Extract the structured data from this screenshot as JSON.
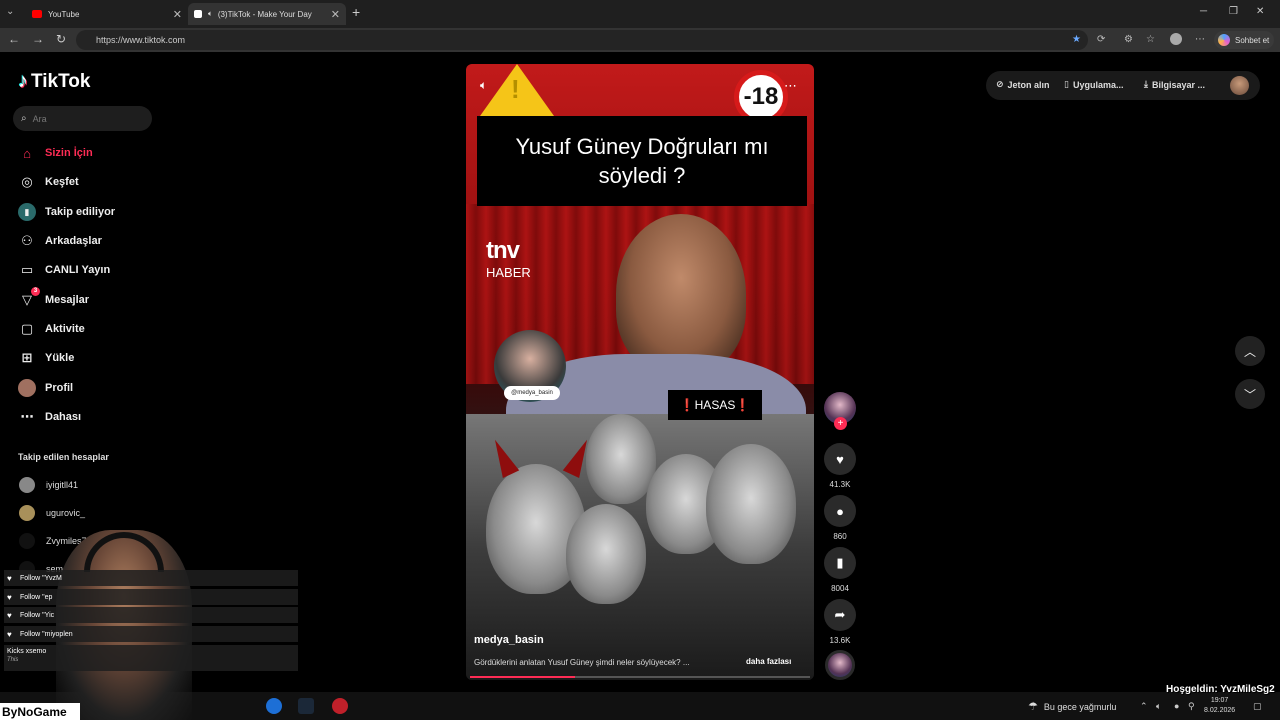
{
  "browser": {
    "tabs": [
      {
        "title": "YouTube",
        "color": "#ff0000"
      },
      {
        "title": "(3)TikTok - Make Your Day",
        "color": "#ffffff"
      }
    ],
    "url": "https://www.tiktok.com",
    "chat_label": "Sohbet et",
    "icons": [
      "back-icon",
      "forward-icon",
      "reload-icon",
      "star-icon",
      "extensions-icon",
      "profile-icon",
      "menu-icon"
    ]
  },
  "sidebar": {
    "logo": "TikTok",
    "search_placeholder": "Ara",
    "nav": [
      {
        "label": "Sizin İçin",
        "icon": "home-icon",
        "active": true
      },
      {
        "label": "Keşfet",
        "icon": "compass-icon"
      },
      {
        "label": "Takip ediliyor",
        "icon": "following-icon"
      },
      {
        "label": "Arkadaşlar",
        "icon": "friends-icon"
      },
      {
        "label": "CANLI Yayın",
        "icon": "live-icon"
      },
      {
        "label": "Mesajlar",
        "icon": "message-icon",
        "badge": "3"
      },
      {
        "label": "Aktivite",
        "icon": "activity-icon"
      },
      {
        "label": "Yükle",
        "icon": "upload-icon"
      },
      {
        "label": "Profil",
        "icon": "profile-icon"
      },
      {
        "label": "Dahası",
        "icon": "more-icon"
      }
    ],
    "following_title": "Takip edilen hesaplar",
    "following": [
      "iyigitll41",
      "ugurovic_",
      "Zvymiles7",
      "semo"
    ]
  },
  "video": {
    "title": "Yusuf Güney Doğruları mı söyledi ?",
    "channel_logo": "tnv",
    "channel_sub": "HABER",
    "age_label": "-18",
    "overlay_handle": "@medya_basin",
    "hasas": "❗HASAS❗",
    "username": "medya_basin",
    "description": "Gördüklerini anlatan Yusuf Güney şimdi neler söylüyecek? ...",
    "more": "daha fazlası",
    "progress": 0.31
  },
  "actions": {
    "likes": "41.3K",
    "comments": "860",
    "saves": "8004",
    "shares": "13.6K"
  },
  "topbar": {
    "coins": "Jeton alın",
    "app": "Uygulama...",
    "desktop": "Bilgisayar ..."
  },
  "stream": {
    "chat": [
      "Follow \"YvzM",
      "Follow \"ep",
      "Follow \"Yic",
      "Follow \"miyoplen"
    ],
    "kicks_label": "Kicks xsemo",
    "kicks_sub": "This",
    "brand": "ByNoGame",
    "welcome": "Hoşgeldin: YvzMileSg2"
  },
  "taskbar": {
    "weather": "Bu gece yağmurlu",
    "time": "19:07",
    "date": "8.02.2026"
  }
}
